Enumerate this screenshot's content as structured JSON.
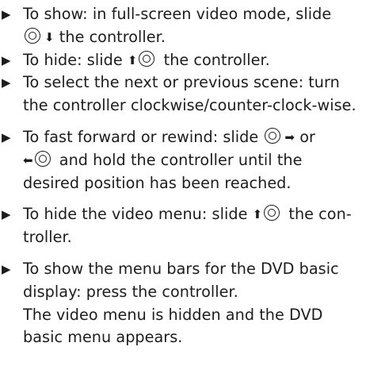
{
  "bullet_glyph": "▶",
  "arrows": {
    "down": "⬇",
    "up": "⬆",
    "right": "➡",
    "left": "⬅"
  },
  "items": [
    {
      "part1": "To show: in full-screen video mode, slide",
      "part2": "the controller."
    },
    {
      "part1": "To hide: slide",
      "part2": "the controller."
    },
    {
      "text": "To select the next or previous scene: turn the controller clockwise/counter-clock-wise."
    },
    {
      "part1": "To fast forward or rewind: slide",
      "part2": "or",
      "part3": "and hold the controller until the desired position has been reached."
    },
    {
      "part1": "To hide the video menu: slide",
      "part2": "the con-troller."
    },
    {
      "text": "To show the menu bars for the DVD basic display: press the controller.",
      "note": "The video menu is hidden and the DVD basic menu appears."
    }
  ]
}
